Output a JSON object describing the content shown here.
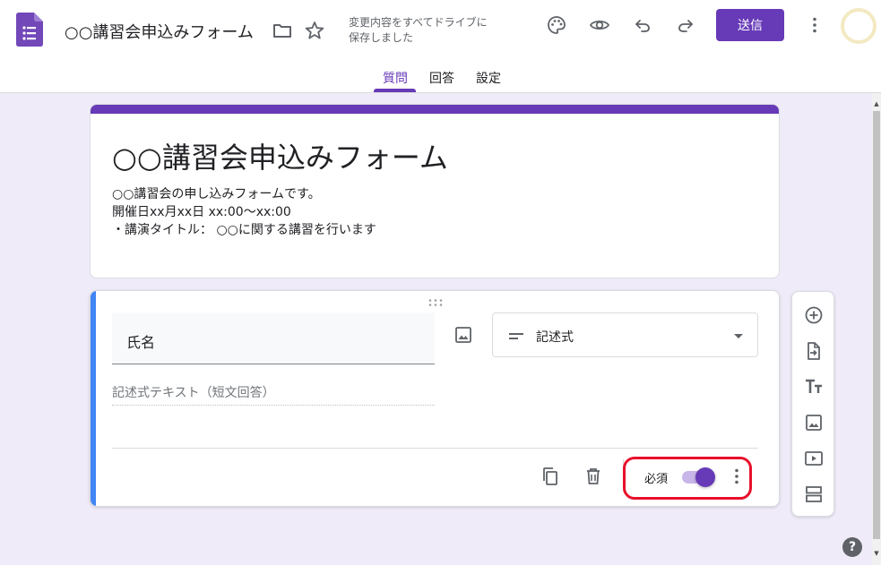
{
  "header": {
    "doc_title": "○○講習会申込みフォーム",
    "save_status_line1": "変更内容をすべてドライブに",
    "save_status_line2": "保存しました",
    "send_label": "送信"
  },
  "tabs": [
    {
      "label": "質問",
      "active": true
    },
    {
      "label": "回答",
      "active": false
    },
    {
      "label": "設定",
      "active": false
    }
  ],
  "form": {
    "title": "○○講習会申込みフォーム",
    "description": [
      "○○講習会の申し込みフォームです。",
      "開催日xx月xx日 xx:00〜xx:00",
      "・講演タイトル： ○○に関する講習を行います"
    ]
  },
  "question": {
    "title": "氏名",
    "type_label": "記述式",
    "answer_placeholder": "記述式テキスト（短文回答）",
    "required_label": "必須",
    "required": true
  },
  "colors": {
    "accent": "#673ab7",
    "active_question_bar": "#4285f4",
    "highlight": "#e8102b",
    "background": "#f0ebf8"
  },
  "icons": {
    "header": [
      "folder-icon",
      "star-icon",
      "palette-icon",
      "eye-icon",
      "undo-icon",
      "redo-icon",
      "more-vert-icon"
    ],
    "toolbar": [
      "add-question-icon",
      "import-questions-icon",
      "add-title-icon",
      "add-image-icon",
      "add-video-icon",
      "add-section-icon"
    ]
  }
}
